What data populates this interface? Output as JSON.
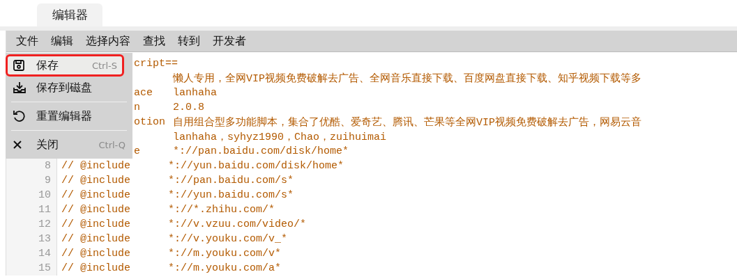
{
  "tabs": [
    {
      "label": "编辑器"
    }
  ],
  "menubar": [
    {
      "label": "文件"
    },
    {
      "label": "编辑"
    },
    {
      "label": "选择内容"
    },
    {
      "label": "查找"
    },
    {
      "label": "转到"
    },
    {
      "label": "开发者"
    }
  ],
  "file_menu": [
    {
      "kind": "item",
      "label": "保存",
      "shortcut": "Ctrl-S",
      "selected": true
    },
    {
      "kind": "item",
      "label": "保存到磁盘",
      "selected": false
    },
    {
      "kind": "separator"
    },
    {
      "kind": "item",
      "label": "重置编辑器",
      "selected": false
    },
    {
      "kind": "separator"
    },
    {
      "kind": "item",
      "label": "关闭",
      "shortcut": "Ctrl-Q",
      "selected": false
    }
  ],
  "code_lines": [
    {
      "kind": "covered",
      "key": "cript=="
    },
    {
      "kind": "covered",
      "value": "懒人专用，全网VIP视频免费破解去广告、全网音乐直接下载、百度网盘直接下载、知乎视频下载等多"
    },
    {
      "kind": "covered",
      "key": "ace",
      "value": "lanhaha"
    },
    {
      "kind": "covered",
      "key": "n",
      "value": "2.0.8"
    },
    {
      "kind": "covered",
      "key": "otion",
      "value": "自用组合型多功能脚本，集合了优酷、爱奇艺、腾讯、芒果等全网VIP视频免费破解去广告，网易云音"
    },
    {
      "kind": "covered",
      "value": "lanhaha，syhyz1990，Chao，zuihuimai"
    },
    {
      "kind": "covered",
      "key": "e",
      "value": "*://pan.baidu.com/disk/home*"
    },
    {
      "kind": "full",
      "number": "8",
      "key": "// @include",
      "value": "*://yun.baidu.com/disk/home*"
    },
    {
      "kind": "full",
      "number": "9",
      "key": "// @include",
      "value": "*://pan.baidu.com/s*"
    },
    {
      "kind": "full",
      "number": "10",
      "key": "// @include",
      "value": "*://yun.baidu.com/s*"
    },
    {
      "kind": "full",
      "number": "11",
      "key": "// @include",
      "value": "*://*.zhihu.com/*"
    },
    {
      "kind": "full",
      "number": "12",
      "key": "// @include",
      "value": "*://v.vzuu.com/video/*"
    },
    {
      "kind": "full",
      "number": "13",
      "key": "// @include",
      "value": "*://v.youku.com/v_*"
    },
    {
      "kind": "full",
      "number": "14",
      "key": "// @include",
      "value": "*://m.youku.com/v*"
    },
    {
      "kind": "full",
      "number": "15",
      "key": "// @include",
      "value": "*://m.youku.com/a*"
    }
  ]
}
